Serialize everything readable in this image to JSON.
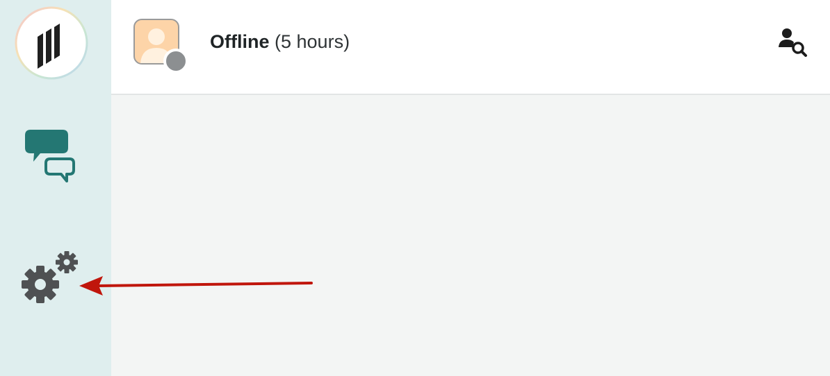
{
  "sidebar": {
    "logo_icon": "app-logo-icon",
    "nav": [
      {
        "icon": "chat-bubbles-icon"
      },
      {
        "icon": "settings-gears-icon"
      }
    ]
  },
  "header": {
    "status_label": "Offline",
    "status_duration": "(5 hours)",
    "status_color": "#8c8f91",
    "search_icon": "user-search-icon"
  },
  "annotation": {
    "arrow_color": "#c0160c",
    "points_to": "settings-gears-icon"
  },
  "colors": {
    "sidebar_bg": "#dfeeee",
    "accent": "#247773",
    "content_bg": "#f3f5f4"
  }
}
